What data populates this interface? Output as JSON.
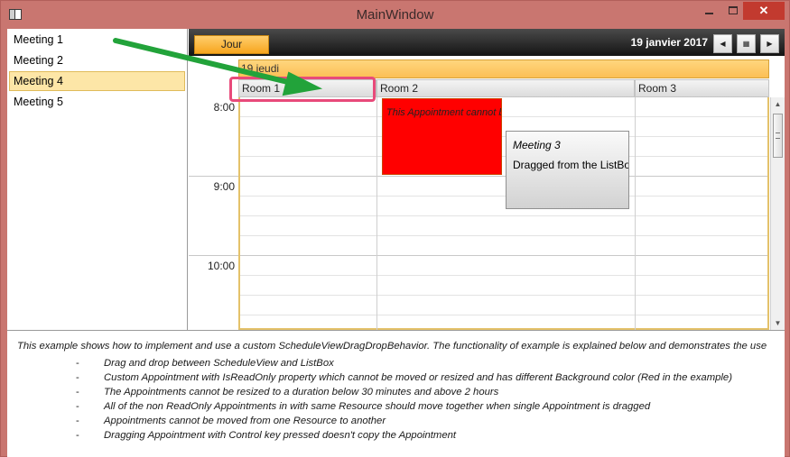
{
  "window": {
    "title": "MainWindow"
  },
  "meetings": [
    {
      "label": "Meeting 1",
      "selected": false
    },
    {
      "label": "Meeting 2",
      "selected": false
    },
    {
      "label": "Meeting 4",
      "selected": true
    },
    {
      "label": "Meeting 5",
      "selected": false
    }
  ],
  "schedule": {
    "view_tab": "Jour",
    "date": "19 janvier 2017",
    "day_header": "19 jeudi",
    "resources": [
      "Room 1",
      "Room 2",
      "Room 3"
    ],
    "times": [
      "8:00",
      "9:00",
      "10:00"
    ],
    "readonly_appointment": "This Appointment cannot be moved or resized",
    "drag_visual": {
      "title": "Meeting 3",
      "body": "Dragged from the ListBox"
    }
  },
  "description": {
    "intro": "This example shows how to implement and use a custom ScheduleViewDragDropBehavior. The functionality of example is explained below and demonstrates the use",
    "dash": "-",
    "bullets": [
      "Drag and drop between ScheduleView and ListBox",
      "Custom Appointment with IsReadOnly property which cannot be moved or resized and has different Background color (Red in the example)",
      "The Appointments cannot be resized to a duration below 30 minutes and above 2 hours",
      "All of the non ReadOnly Appointments in with same Resource should move together when single Appointment is dragged",
      "Appointments cannot be moved from one Resource to another",
      "Dragging Appointment with Control key pressed doesn't copy the Appointment"
    ]
  },
  "icons": {
    "app": "app-icon",
    "minimize": "minimize-icon",
    "maximize": "maximize-icon",
    "close": "close-icon",
    "prev": "chevron-left-icon",
    "calendar": "calendar-grid-icon",
    "next": "chevron-right-icon",
    "arrow": "green-arrow-annotation"
  },
  "colors": {
    "window_frame": "#c97670",
    "close_button": "#c23a2f",
    "tab_orange": "#f7a51e",
    "readonly_appointment": "#ff0000",
    "highlight": "#e84a7a",
    "annotation_arrow": "#22a33a"
  }
}
